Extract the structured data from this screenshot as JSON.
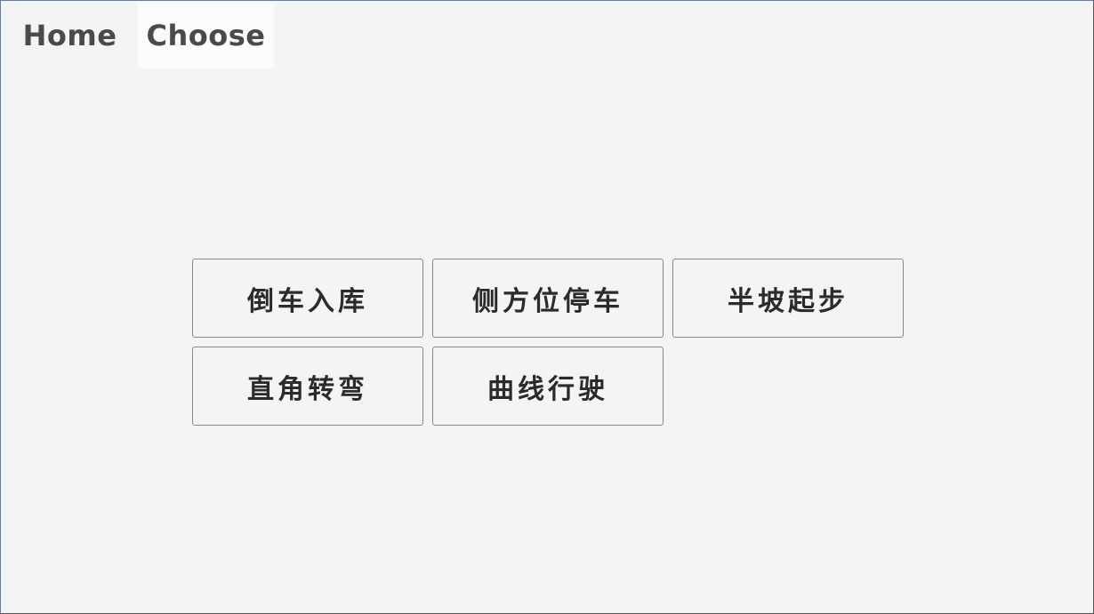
{
  "tabs": [
    {
      "label": "Home",
      "active": false
    },
    {
      "label": "Choose",
      "active": true
    }
  ],
  "options": [
    {
      "label": "倒车入库"
    },
    {
      "label": "侧方位停车"
    },
    {
      "label": "半坡起步"
    },
    {
      "label": "直角转弯"
    },
    {
      "label": "曲线行驶"
    }
  ]
}
